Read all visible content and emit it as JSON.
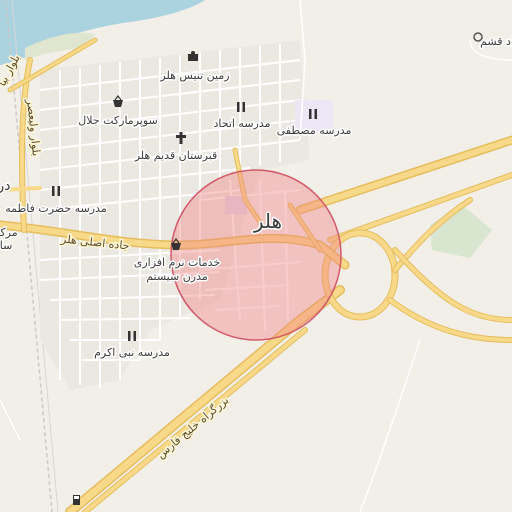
{
  "map": {
    "city_label": "هلر",
    "main_road_label": "جاده اصلی هلر",
    "highway_label": "بزرگراه خلیج فارس",
    "pois": {
      "tennis": "زمین تنیس هلر",
      "supermarket": "سوپرمارکت جلال",
      "school_ettehad": "مدرسه اتحاد",
      "school_mostafa": "مدرسه مصطفی",
      "cemetery": "قبرستان قدیم هلر",
      "school_fatemeh": "مدرسه حضرت فاطمه",
      "service_center": "خدمات نرم افزاری\nمدرن سیستم",
      "school_nabi": "مدرسه نبی اکرم",
      "qeshm_partial": "اد قشم"
    },
    "partial_labels": {
      "left_vertical_1": "بلوار بیا",
      "left_vertical_2": "بلوار ولیعصر",
      "left_edge_1": "در",
      "left_edge_2": "مرکز",
      "left_edge_3": "سا"
    },
    "colors": {
      "land": "#f2efe9",
      "water": "#aad3df",
      "road_major": "#f8d98a",
      "road_major_casing": "#e5bd5c",
      "residential": "#ffffff",
      "park": "#d8e5cf",
      "highlight_fill": "#f08080",
      "highlight_stroke": "#d35a6a",
      "school_area": "#ece6f5"
    },
    "icons": {
      "school": "school-icon",
      "supermarket": "basket-icon",
      "tennis": "tennis-icon",
      "cemetery": "cross-icon",
      "shop": "shop-icon",
      "fuel": "fuel-icon",
      "place": "place-marker-icon"
    }
  }
}
